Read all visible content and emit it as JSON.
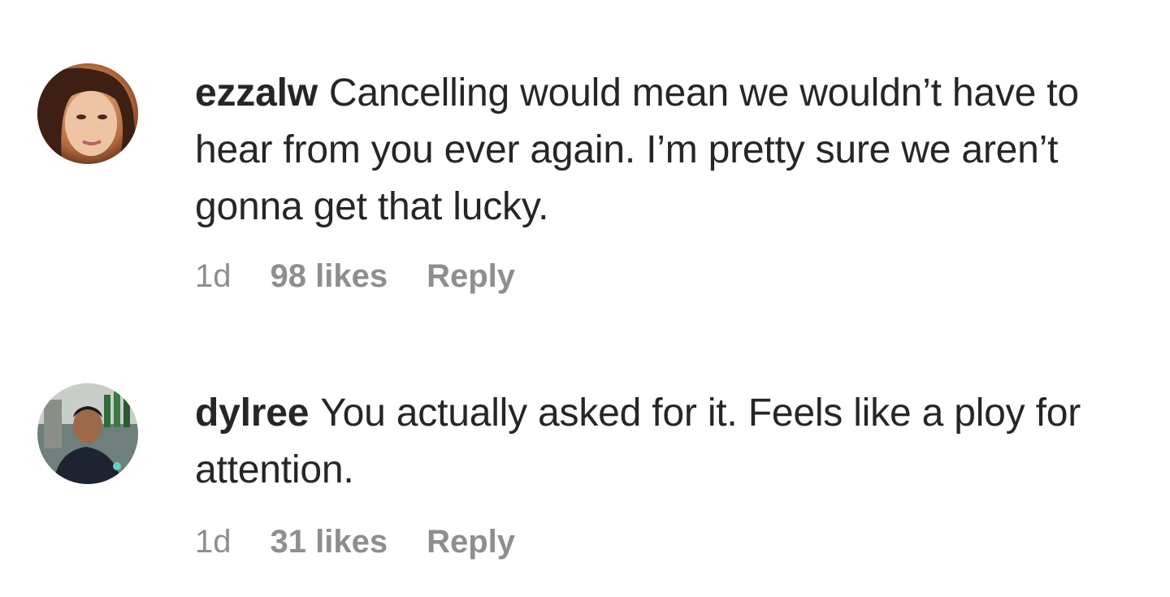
{
  "comments": [
    {
      "username": "ezzalw",
      "text": "Cancelling would mean we wouldn’t have to hear from you ever again. I’m pretty sure we aren’t gonna get that lucky.",
      "time": "1d",
      "likes": "98 likes",
      "reply_label": "Reply"
    },
    {
      "username": "dylree",
      "text": "You actually asked for it. Feels like a ploy for attention.",
      "time": "1d",
      "likes": "31 likes",
      "reply_label": "Reply"
    }
  ],
  "colors": {
    "text": "#262626",
    "meta": "#8e8e8e",
    "background": "#ffffff"
  }
}
